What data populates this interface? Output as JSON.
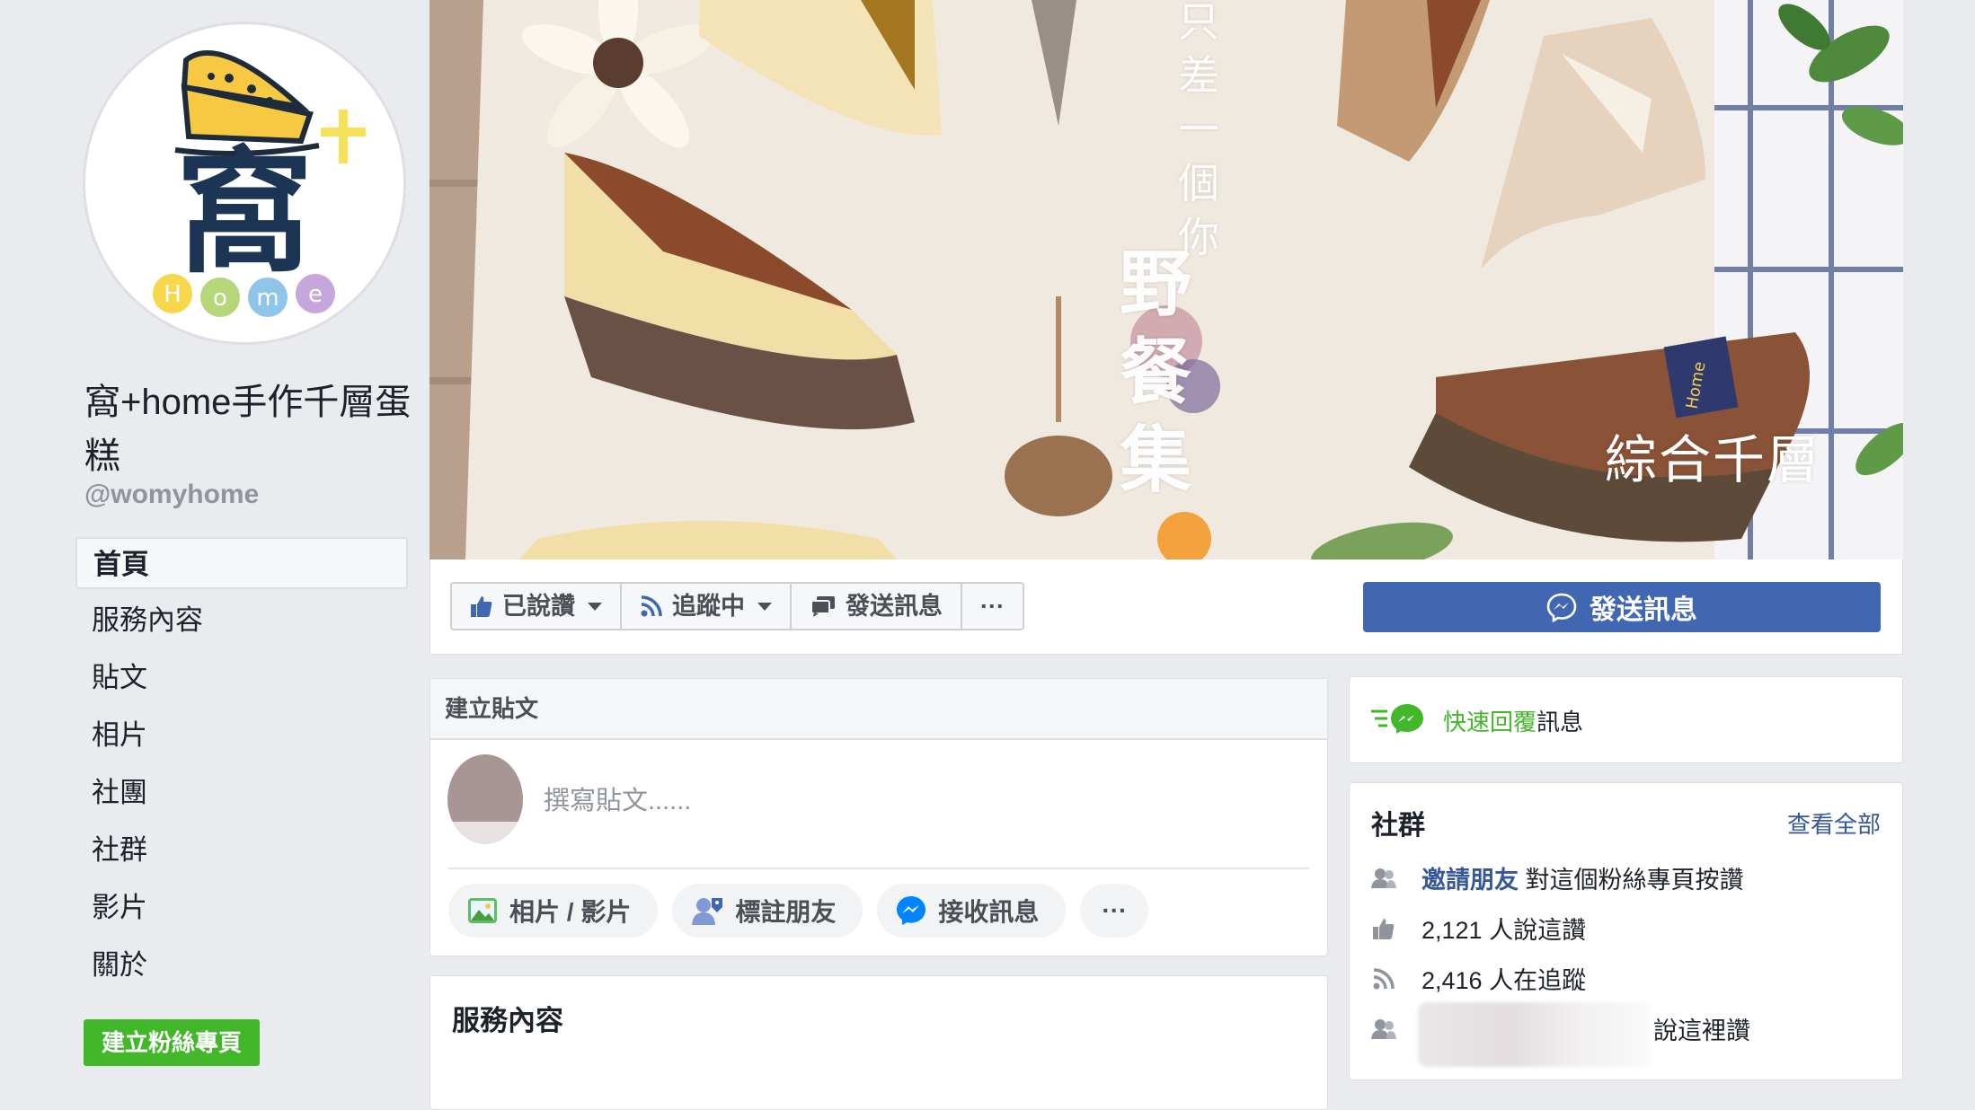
{
  "profile": {
    "logo_text": "窩",
    "logo_letters": [
      "H",
      "o",
      "m",
      "e"
    ],
    "name": "窩+home手作千層蛋糕",
    "handle": "@womyhome"
  },
  "nav": {
    "items": [
      "首頁",
      "服務內容",
      "貼文",
      "相片",
      "社團",
      "社群",
      "影片",
      "關於"
    ],
    "active": "首頁"
  },
  "create_page_label": "建立粉絲專頁",
  "cover": {
    "vertical_text_1": "只差一個你",
    "vertical_text_2": "野餐集",
    "label": "綜合千層",
    "box_text": "Home"
  },
  "actions": {
    "liked_label": "已說讚",
    "following_label": "追蹤中",
    "message_label": "發送訊息",
    "more_label": "···",
    "send_message_label": "發送訊息"
  },
  "composer": {
    "title": "建立貼文",
    "placeholder": "撰寫貼文......",
    "buttons": [
      "相片 / 影片",
      "標註朋友",
      "接收訊息"
    ],
    "more_label": "···"
  },
  "services": {
    "title": "服務內容"
  },
  "quick_reply": {
    "highlight": "快速回覆",
    "rest": "訊息"
  },
  "community": {
    "title": "社群",
    "see_all": "查看全部",
    "invite_link": "邀請朋友",
    "invite_rest": "對這個粉絲專頁按讚",
    "likes_text": "2,121 人說這讚",
    "follows_text": "2,416 人在追蹤",
    "friends_suffix": "說這裡讚"
  },
  "colors": {
    "facebook_blue": "#4267b2",
    "link_blue": "#365899",
    "green": "#42b72a",
    "background": "#e9ebee"
  },
  "icons": [
    "thumbs-up-icon",
    "rss-icon",
    "chat-icon",
    "messenger-icon",
    "photo-icon",
    "tag-friend-icon",
    "users-icon",
    "caret-down-icon"
  ]
}
